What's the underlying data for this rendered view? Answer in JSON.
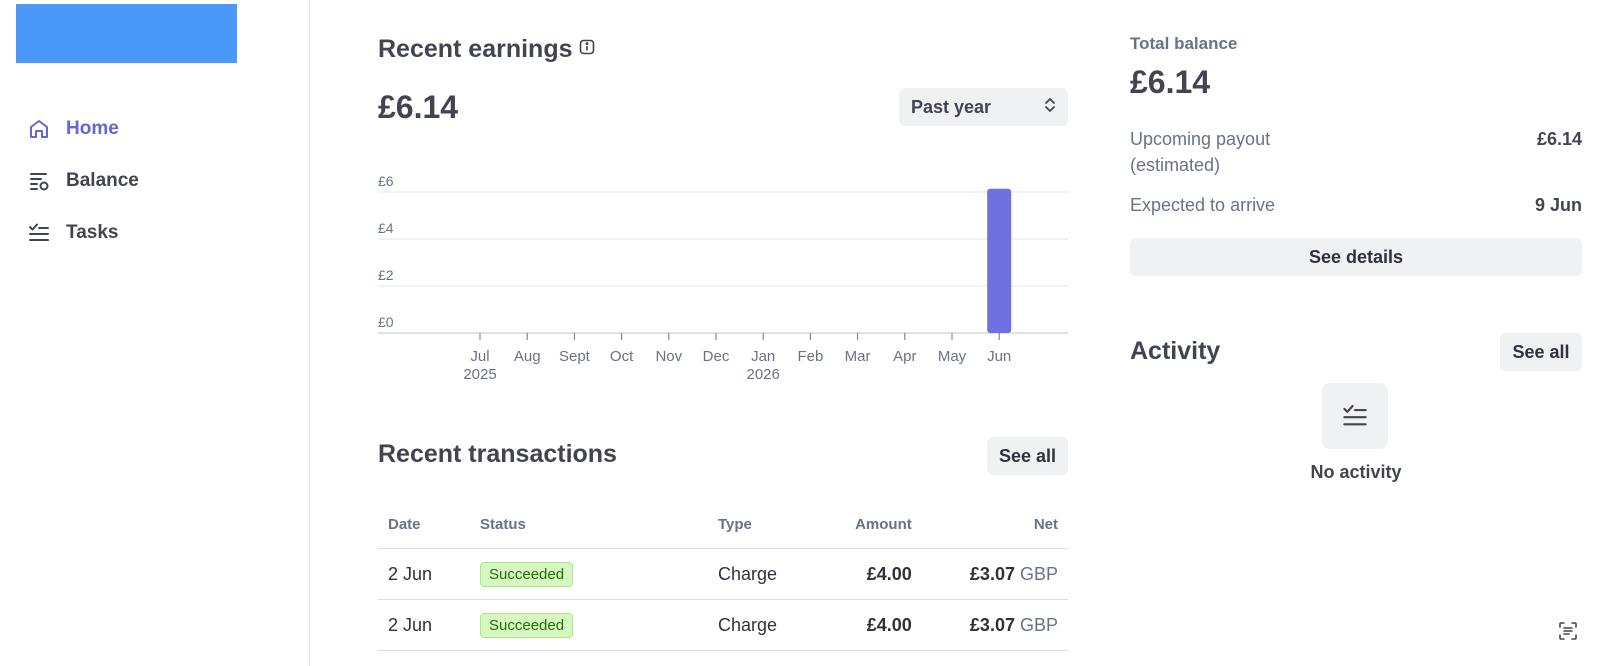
{
  "sidebar": {
    "items": [
      {
        "label": "Home",
        "icon": "home-icon",
        "active": true
      },
      {
        "label": "Balance",
        "icon": "balance-list-icon",
        "active": false
      },
      {
        "label": "Tasks",
        "icon": "tasks-icon",
        "active": false
      }
    ]
  },
  "earnings": {
    "title": "Recent earnings",
    "amount": "£6.14",
    "range_select": "Past year"
  },
  "chart_data": {
    "type": "bar",
    "categories": [
      "Jul 2025",
      "Aug",
      "Sept",
      "Oct",
      "Nov",
      "Dec",
      "Jan 2026",
      "Feb",
      "Mar",
      "Apr",
      "May",
      "Jun"
    ],
    "values": [
      0,
      0,
      0,
      0,
      0,
      0,
      0,
      0,
      0,
      0,
      0,
      6.14
    ],
    "ylim": [
      0,
      6
    ],
    "yticks": [
      "£0",
      "£2",
      "£4",
      "£6"
    ],
    "xlabel": "",
    "ylabel": "",
    "bar_color": "#7071e0",
    "grid": true
  },
  "transactions": {
    "title": "Recent transactions",
    "see_all": "See all",
    "columns": [
      "Date",
      "Status",
      "Type",
      "Amount",
      "Net"
    ],
    "rows": [
      {
        "date": "2 Jun",
        "status": "Succeeded",
        "type": "Charge",
        "amount": "£4.00",
        "net": "£3.07",
        "currency": "GBP"
      },
      {
        "date": "2 Jun",
        "status": "Succeeded",
        "type": "Charge",
        "amount": "£4.00",
        "net": "£3.07",
        "currency": "GBP"
      }
    ]
  },
  "balance": {
    "title": "Total balance",
    "amount": "£6.14",
    "upcoming_label_1": "Upcoming payout",
    "upcoming_label_2": "(estimated)",
    "upcoming_value": "£6.14",
    "arrive_label": "Expected to arrive",
    "arrive_value": "9 Jun",
    "details_button": "See details"
  },
  "activity": {
    "title": "Activity",
    "see_all": "See all",
    "empty_text": "No activity"
  },
  "colors": {
    "accent": "#6266d6",
    "logo": "#4a98f8",
    "success_bg": "#d7f7c2",
    "success_text": "#217005"
  }
}
